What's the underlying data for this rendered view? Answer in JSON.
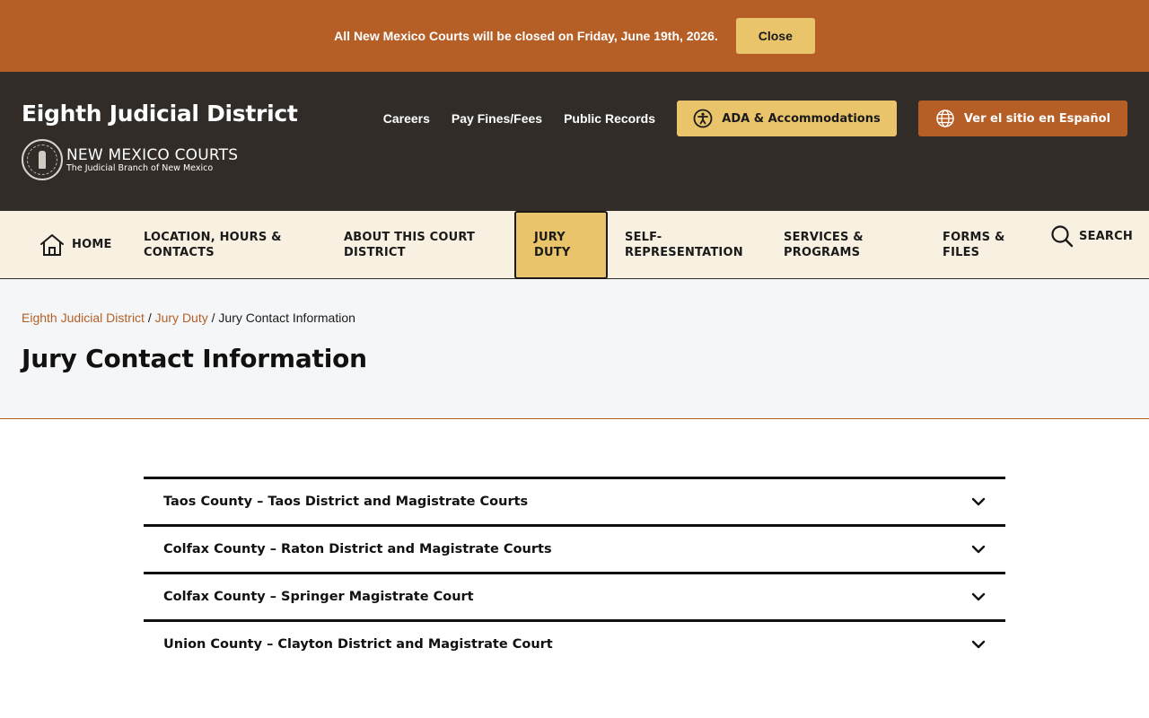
{
  "alert": {
    "message": "All New Mexico Courts will be closed on Friday, June 19th, 2026.",
    "close_label": "Close"
  },
  "header": {
    "site_title": "Eighth Judicial District",
    "logo_main": "NEW MEXICO COURTS",
    "logo_sub": "The Judicial Branch of New Mexico",
    "utility_links": [
      "Careers",
      "Pay Fines/Fees",
      "Public Records"
    ],
    "ada_label": "ADA & Accommodations",
    "spanish_label": "Ver el sitio en Español"
  },
  "nav": {
    "home": "HOME",
    "location": "LOCATION, HOURS & CONTACTS",
    "about": "ABOUT THIS COURT DISTRICT",
    "jury": "JURY DUTY",
    "self_rep": "SELF-REPRESENTATION",
    "services": "SERVICES & PROGRAMS",
    "forms": "FORMS & FILES",
    "search": "SEARCH"
  },
  "breadcrumb": {
    "items": [
      "Eighth Judicial District",
      "Jury Duty"
    ],
    "current": "Jury Contact Information",
    "separator": "/"
  },
  "page_title": "Jury Contact Information",
  "accordion": [
    "Taos County – Taos District and Magistrate Courts",
    "Colfax County – Raton District and Magistrate Courts",
    "Colfax County – Springer Magistrate Court",
    "Union County – Clayton District and Magistrate Court"
  ],
  "colors": {
    "accent_orange": "#b55f27",
    "accent_gold": "#e9c46a",
    "header_dark": "#312c28",
    "nav_bg": "#f8f0e0"
  },
  "icons": {
    "ada": "accessibility-icon",
    "spanish": "globe-icon",
    "home": "home-icon",
    "search": "search-icon",
    "accordion": "chevron-down-icon"
  }
}
